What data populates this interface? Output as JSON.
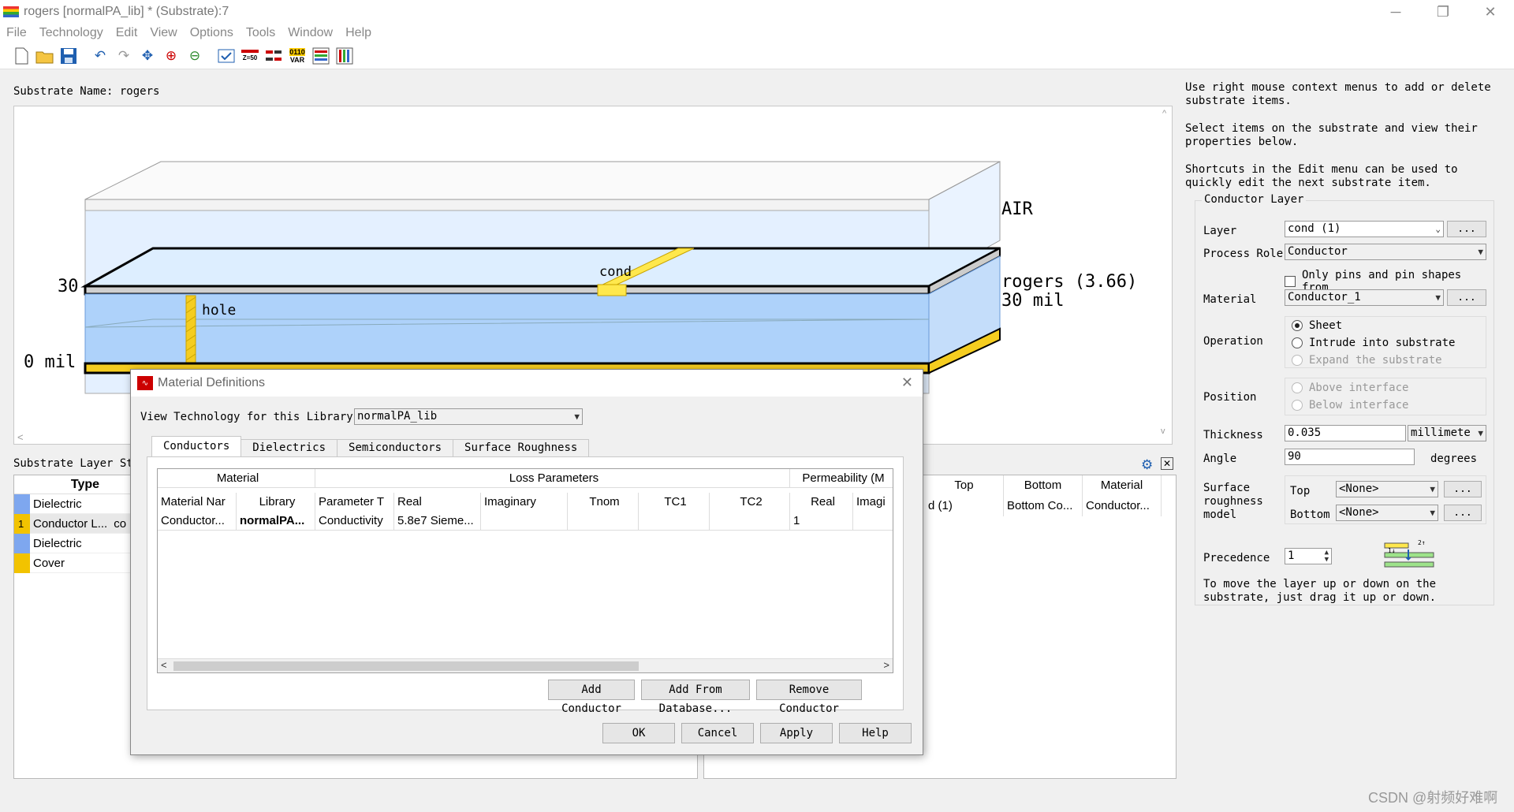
{
  "window": {
    "title": "rogers [normalPA_lib] * (Substrate):7",
    "minimize": "─",
    "restore": "❐",
    "close": "✕"
  },
  "menu": [
    "File",
    "Technology",
    "Edit",
    "View",
    "Options",
    "Tools",
    "Window",
    "Help"
  ],
  "toolbar": {
    "icons": [
      "new-file",
      "open-folder",
      "save",
      "undo",
      "redo",
      "pan",
      "zoom-in",
      "zoom-out",
      "check",
      "z-50",
      "split",
      "var",
      "layers-red",
      "layers-blue"
    ],
    "labels": {
      "z50": "Z=50",
      "var": "VAR",
      "bits": "0110"
    }
  },
  "substrate": {
    "name_label": "Substrate Name:",
    "name": "rogers"
  },
  "canvas": {
    "air": "AIR",
    "dielectric_line1": "rogers (3.66)",
    "dielectric_line2": "30 mil",
    "y30": "30",
    "y0": "0 mil",
    "hole": "hole",
    "cond": "cond"
  },
  "layer_stack": {
    "title": "Substrate Layer Sta",
    "header": "Type",
    "rows": [
      {
        "num": "",
        "type": "Dielectric",
        "color": "#7ea7ef"
      },
      {
        "num": "1",
        "type": "Conductor L...",
        "extra": "co",
        "color": "#f2c300"
      },
      {
        "num": "",
        "type": "Dielectric",
        "color": "#7ea7ef"
      },
      {
        "num": "",
        "type": "Cover",
        "color": "#f2c300"
      }
    ]
  },
  "cond_table": {
    "headers": [
      "Top",
      "Bottom",
      "Material"
    ],
    "row": [
      "d (1)",
      "Bottom Co...",
      "Conductor..."
    ]
  },
  "info": {
    "line1": "Use right mouse context menus to add or delete substrate items.",
    "line2": "Select items on the substrate and view their properties below.",
    "line3": "Shortcuts in the Edit menu can be used to quickly edit the next substrate item."
  },
  "props": {
    "group": "Conductor Layer",
    "layer_label": "Layer",
    "layer_value": "cond (1)",
    "role_label": "Process Role",
    "role_value": "Conductor",
    "only_pins": "Only pins and pin shapes from",
    "material_label": "Material",
    "material_value": "Conductor_1",
    "operation_label": "Operation",
    "op1": "Sheet",
    "op2": "Intrude into substrate",
    "op3": "Expand the substrate",
    "position_label": "Position",
    "pos1": "Above interface",
    "pos2": "Below interface",
    "thickness_label": "Thickness",
    "thickness_value": "0.035",
    "thickness_unit": "millimete",
    "angle_label": "Angle",
    "angle_value": "90",
    "angle_unit": "degrees",
    "surface_label1": "Surface",
    "surface_label2": "roughness",
    "surface_label3": "model",
    "top_label": "Top",
    "top_value": "<None>",
    "bottom_label": "Bottom",
    "bottom_value": "<None>",
    "precedence_label": "Precedence",
    "precedence_value": "1",
    "move_hint": "To move the layer up or down on the substrate, just drag it up or down.",
    "ellipsis": "..."
  },
  "dialog": {
    "title": "Material Definitions",
    "view_label": "View Technology for this Library:",
    "library": "normalPA_lib",
    "tabs": [
      "Conductors",
      "Dielectrics",
      "Semiconductors",
      "Surface Roughness"
    ],
    "group_headers": {
      "material": "Material",
      "loss": "Loss Parameters",
      "perm": "Permeability (M"
    },
    "columns": [
      "Material Nar",
      "Library",
      "Parameter T",
      "Real",
      "Imaginary",
      "Tnom",
      "TC1",
      "TC2",
      "Real",
      "Imagi"
    ],
    "row": [
      "Conductor...",
      "normalPA...",
      "Conductivity",
      "5.8e7 Sieme...",
      "",
      "",
      "",
      "",
      "1",
      ""
    ],
    "add_conductor": "Add Conductor",
    "add_db": "Add From Database...",
    "remove": "Remove Conductor",
    "ok": "OK",
    "cancel": "Cancel",
    "apply": "Apply",
    "help": "Help",
    "close": "✕"
  },
  "watermark": "CSDN @射频好难啊"
}
